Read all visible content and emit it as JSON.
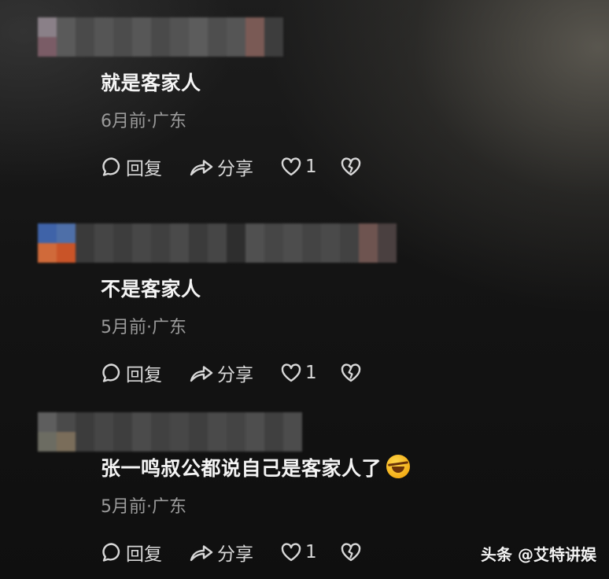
{
  "comments": [
    {
      "text": "就是客家人",
      "meta": "6月前·广东",
      "reply_label": "回复",
      "share_label": "分享",
      "like_count": "1"
    },
    {
      "text": "不是客家人",
      "meta": "5月前·广东",
      "reply_label": "回复",
      "share_label": "分享",
      "like_count": "1"
    },
    {
      "text": "张一鸣叔公都说自己是客家人了",
      "emoji": "rolling-on-floor-laughing",
      "meta": "5月前·广东",
      "reply_label": "回复",
      "share_label": "分享",
      "like_count": "1"
    }
  ],
  "watermark": "头条 @艾特讲娱",
  "colors": {
    "background": "#141414",
    "text_primary": "#f4f4f4",
    "text_secondary": "#9a9a9a",
    "icon": "#d8d8d8"
  },
  "icons": {
    "reply": "comment-bubble-icon",
    "share": "share-arrow-icon",
    "like": "heart-outline-icon",
    "dislike": "broken-heart-icon"
  }
}
